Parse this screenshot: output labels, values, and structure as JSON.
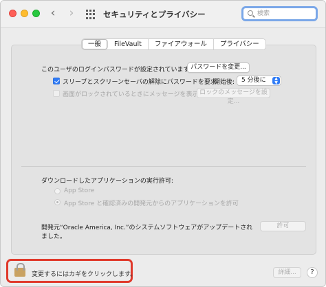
{
  "window": {
    "title": "セキュリティとプライバシー",
    "search": {
      "placeholder": "検索",
      "value": ""
    },
    "nav_back": "‹",
    "nav_forward": "›"
  },
  "tabs": [
    {
      "label": "一般",
      "active": true
    },
    {
      "label": "FileVault",
      "active": false
    },
    {
      "label": "ファイアウォール",
      "active": false
    },
    {
      "label": "プライバシー",
      "active": false
    }
  ],
  "general": {
    "password_text": "このユーザのログインパスワードが設定されています",
    "change_password_button": "パスワードを変更...",
    "require_password_label": "スリープとスクリーンセーバの解除にパスワードを要求",
    "require_password_checked": true,
    "start_after_label": "開始後:",
    "start_after_value": "5 分後に",
    "lock_message_label": "画面がロックされているときにメッセージを表示",
    "lock_message_checked": false,
    "set_lock_message_button": "ロックのメッセージを設定...",
    "download_heading": "ダウンロードしたアプリケーションの実行許可:",
    "radio_options": [
      {
        "label": "App Store",
        "selected": false
      },
      {
        "label": "App Store と確認済みの開発元からのアプリケーションを許可",
        "selected": true
      }
    ],
    "blocked_line1": "開発元“Oracle America, Inc.”のシステムソフトウェアがアップデートされ",
    "blocked_line2": "ました。",
    "allow_button": "許可"
  },
  "footer": {
    "lock_text": "変更するにはカギをクリックします。",
    "advanced_button": "詳細...",
    "help_button": "?"
  },
  "colors": {
    "accent": "#2f7bf6",
    "highlight_border": "#e0392b"
  }
}
